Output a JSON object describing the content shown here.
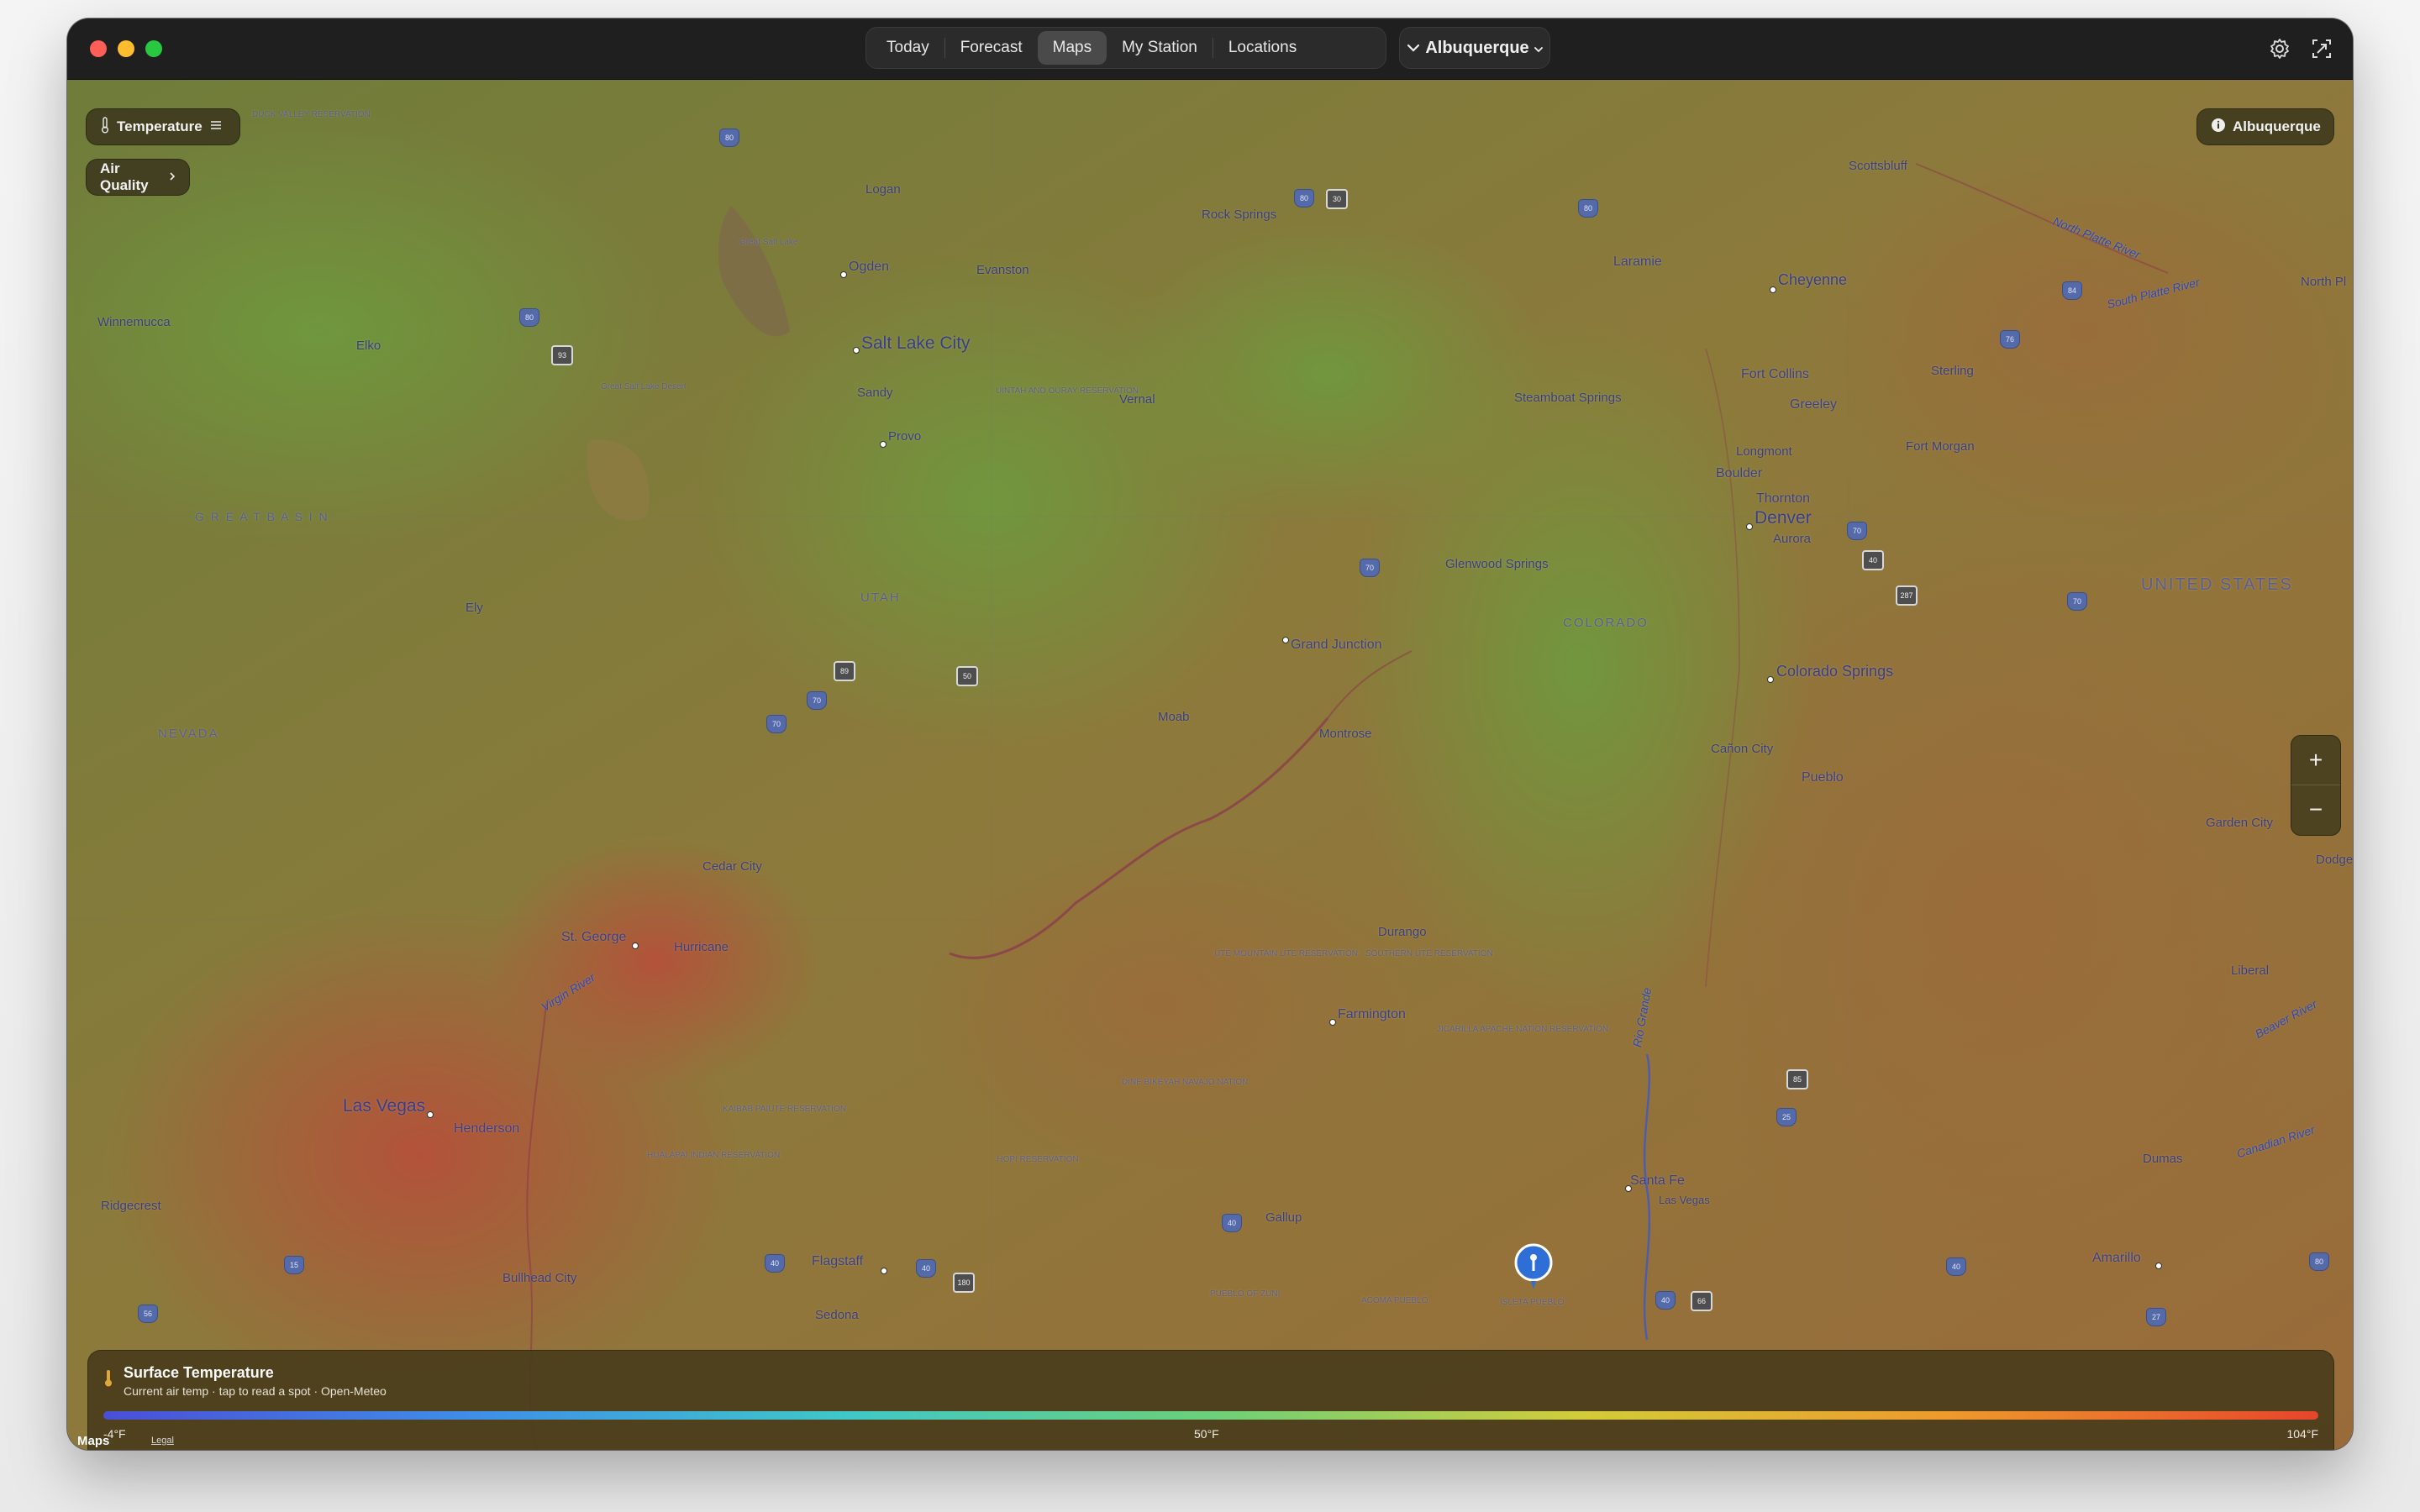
{
  "window": {
    "tabs": [
      {
        "label": "Today",
        "active": false
      },
      {
        "label": "Forecast",
        "active": false
      },
      {
        "label": "Maps",
        "active": true
      },
      {
        "label": "My Station",
        "active": false
      },
      {
        "label": "Locations",
        "active": false
      }
    ],
    "location_button": "Albuquerque",
    "icons": [
      "settings-icon",
      "screenshot-icon"
    ]
  },
  "map": {
    "layer_chip": "Temperature",
    "air_quality_chip": "Air Quality",
    "location_chip": "Albuquerque",
    "zoom_in": "+",
    "zoom_out": "−",
    "credit": "Maps",
    "legal": "Legal",
    "labels": {
      "salt_lake_city": "Salt Lake City",
      "ogden": "Ogden",
      "logan": "Logan",
      "sandy": "Sandy",
      "provo": "Provo",
      "vernal": "Vernal",
      "rock_springs": "Rock Springs",
      "evanston": "Evanston",
      "laramie": "Laramie",
      "cheyenne": "Cheyenne",
      "scottsbluff": "Scottsbluff",
      "fort_collins": "Fort Collins",
      "greeley": "Greeley",
      "sterling": "Sterling",
      "longmont": "Longmont",
      "fort_morgan": "Fort Morgan",
      "boulder": "Boulder",
      "thornton": "Thornton",
      "denver": "Denver",
      "aurora": "Aurora",
      "steamboat": "Steamboat Springs",
      "glenwood": "Glenwood Springs",
      "colorado": "COLORADO",
      "united_states": "UNITED STATES",
      "grand_junction": "Grand Junction",
      "colorado_springs": "Colorado Springs",
      "canon_city": "Cañon City",
      "pueblo": "Pueblo",
      "garden_city": "Garden City",
      "dodge": "Dodge",
      "montrose": "Montrose",
      "moab": "Moab",
      "utah": "UTAH",
      "nevada": "NEVADA",
      "winnemucca": "Winnemucca",
      "elko": "Elko",
      "ely": "Ely",
      "great_basin": "G R E A T   B A S I N",
      "cedar_city": "Cedar City",
      "st_george": "St. George",
      "hurricane": "Hurricane",
      "las_vegas": "Las Vegas",
      "henderson": "Henderson",
      "ridgecrest": "Ridgecrest",
      "bullhead_city": "Bullhead City",
      "flagstaff": "Flagstaff",
      "sedona": "Sedona",
      "gallup": "Gallup",
      "durango": "Durango",
      "farmington": "Farmington",
      "santa_fe": "Santa Fe",
      "las_vegas_nm": "Las Vegas",
      "liberal": "Liberal",
      "dumas": "Dumas",
      "amarillo": "Amarillo",
      "north_pl": "North Pl",
      "virgin_river": "Virgin River",
      "rio_grande": "Rio Grande",
      "north_platte_river": "North Platte River",
      "south_platte_river": "South Platte River",
      "canadian_river": "Canadian River",
      "beaver_river": "Beaver River"
    },
    "regions": {
      "duck_valley": "DUCK VALLEY RESERVATION",
      "uintah": "UINTAH AND OURAY RESERVATION",
      "ute_mountain": "UTE MOUNTAIN UTE RESERVATION",
      "southern_ute": "SOUTHERN UTE RESERVATION",
      "jicarilla": "JICARILLA APACHE NATION RESERVATION",
      "navajo": "DINÉ BIKÉYAH NAVAJO NATION",
      "kaibab": "KAIBAB PAIUTE RESERVATION",
      "hualapai": "HUALAPAI INDIAN RESERVATION",
      "hopi": "HOPI RESERVATION",
      "zuni": "PUEBLO OF ZUNI",
      "acoma": "ACOMA PUEBLO",
      "isleta": "ISLETA PUEBLO",
      "great_salt_lake": "Great Salt Lake",
      "great_salt_desert": "Great Salt Lake Desert"
    },
    "shields": [
      "80",
      "30",
      "80",
      "93",
      "80",
      "80",
      "70",
      "70",
      "40",
      "287",
      "89",
      "70",
      "70",
      "50",
      "15",
      "40",
      "180",
      "40",
      "25",
      "40",
      "66",
      "40",
      "27",
      "40",
      "80",
      "56",
      "85",
      "76",
      "84",
      "70"
    ]
  },
  "legend": {
    "title": "Surface Temperature",
    "subtitle": "Current air temp · tap to read a spot · Open-Meteo",
    "min_label": "-4°F",
    "mid_label": "50°F",
    "max_label": "104°F",
    "gradient_colors": [
      "#4a4fd6",
      "#3f8ee8",
      "#3fc7c9",
      "#6cd07a",
      "#d2cc3a",
      "#ee9a2c",
      "#e6452b"
    ]
  }
}
